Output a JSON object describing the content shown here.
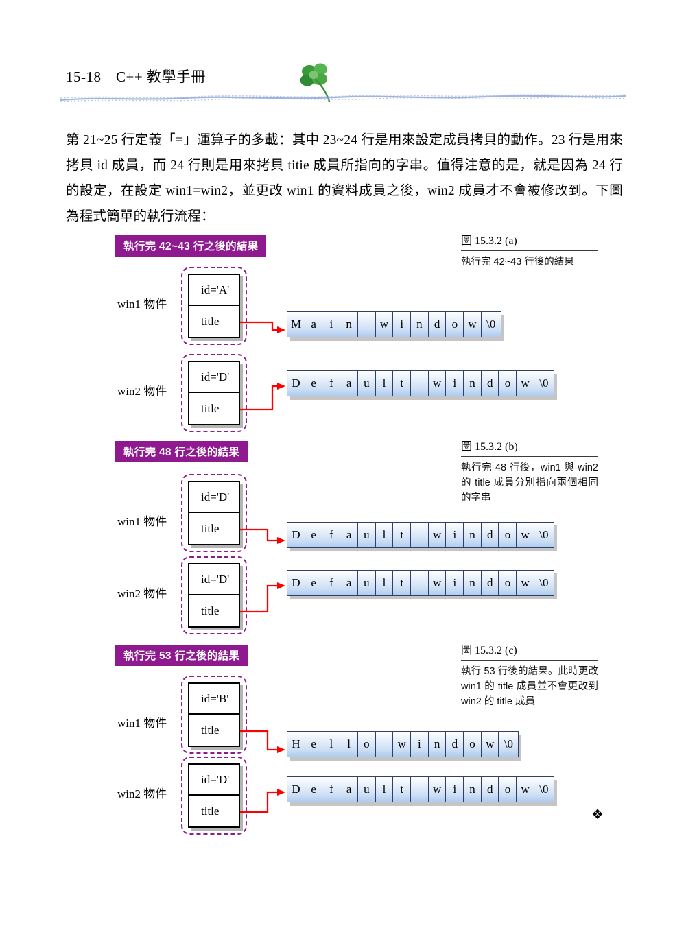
{
  "header": {
    "page_number_and_title": "15-18　C++ 教學手冊",
    "ornament_icon": "clover-icon"
  },
  "body": {
    "paragraph": "第 21~25 行定義「=」運算子的多載：其中 23~24 行是用來設定成員拷貝的動作。23 行是用來拷貝 id 成員，而 24 行則是用來拷貝 titie 成員所指向的字串。值得注意的是，就是因為 24 行的設定，在設定 win1=win2，並更改 win1 的資料成員之後，win2 成員才不會被修改到。下圖為程式簡單的執行流程："
  },
  "figure": {
    "accent_color": "#8f1a8f",
    "arrow_color": "#ff0000",
    "cell_border_color": "#2f3f66",
    "sections": [
      {
        "banner": "執行完 42~43 行之後的結果",
        "caption_title": "圖 15.3.2 (a)",
        "caption_body": "執行完 42~43 行後的結果",
        "objects": [
          {
            "label": "win1 物件",
            "id_field": "id='A'",
            "title_field": "title",
            "string": [
              "M",
              "a",
              "i",
              "n",
              " ",
              "w",
              "i",
              "n",
              "d",
              "o",
              "w",
              "\\0"
            ]
          },
          {
            "label": "win2 物件",
            "id_field": "id='D'",
            "title_field": "title",
            "string": [
              "D",
              "e",
              "f",
              "a",
              "u",
              "l",
              "t",
              " ",
              "w",
              "i",
              "n",
              "d",
              "o",
              "w",
              "\\0"
            ]
          }
        ]
      },
      {
        "banner": "執行完 48 行之後的結果",
        "caption_title": "圖 15.3.2 (b)",
        "caption_body": "執行完 48 行後，win1 與 win2 的 title 成員分別指向兩個相同的字串",
        "objects": [
          {
            "label": "win1 物件",
            "id_field": "id='D'",
            "title_field": "title",
            "string": [
              "D",
              "e",
              "f",
              "a",
              "u",
              "l",
              "t",
              " ",
              "w",
              "i",
              "n",
              "d",
              "o",
              "w",
              "\\0"
            ]
          },
          {
            "label": "win2 物件",
            "id_field": "id='D'",
            "title_field": "title",
            "string": [
              "D",
              "e",
              "f",
              "a",
              "u",
              "l",
              "t",
              " ",
              "w",
              "i",
              "n",
              "d",
              "o",
              "w",
              "\\0"
            ]
          }
        ]
      },
      {
        "banner": "執行完 53 行之後的結果",
        "caption_title": "圖 15.3.2 (c)",
        "caption_body": "執行 53 行後的結果。此時更改 win1 的 title 成員並不會更改到 win2 的 title 成員",
        "objects": [
          {
            "label": "win1 物件",
            "id_field": "id='B'",
            "title_field": "title",
            "string": [
              "H",
              "e",
              "l",
              "l",
              "o",
              " ",
              "w",
              "i",
              "n",
              "d",
              "o",
              "w",
              "\\0"
            ]
          },
          {
            "label": "win2 物件",
            "id_field": "id='D'",
            "title_field": "title",
            "string": [
              "D",
              "e",
              "f",
              "a",
              "u",
              "l",
              "t",
              " ",
              "w",
              "i",
              "n",
              "d",
              "o",
              "w",
              "\\0"
            ]
          }
        ]
      }
    ]
  },
  "footer": {
    "ornament_icon": "floral-diamond-icon",
    "ornament_glyph": "❖"
  }
}
